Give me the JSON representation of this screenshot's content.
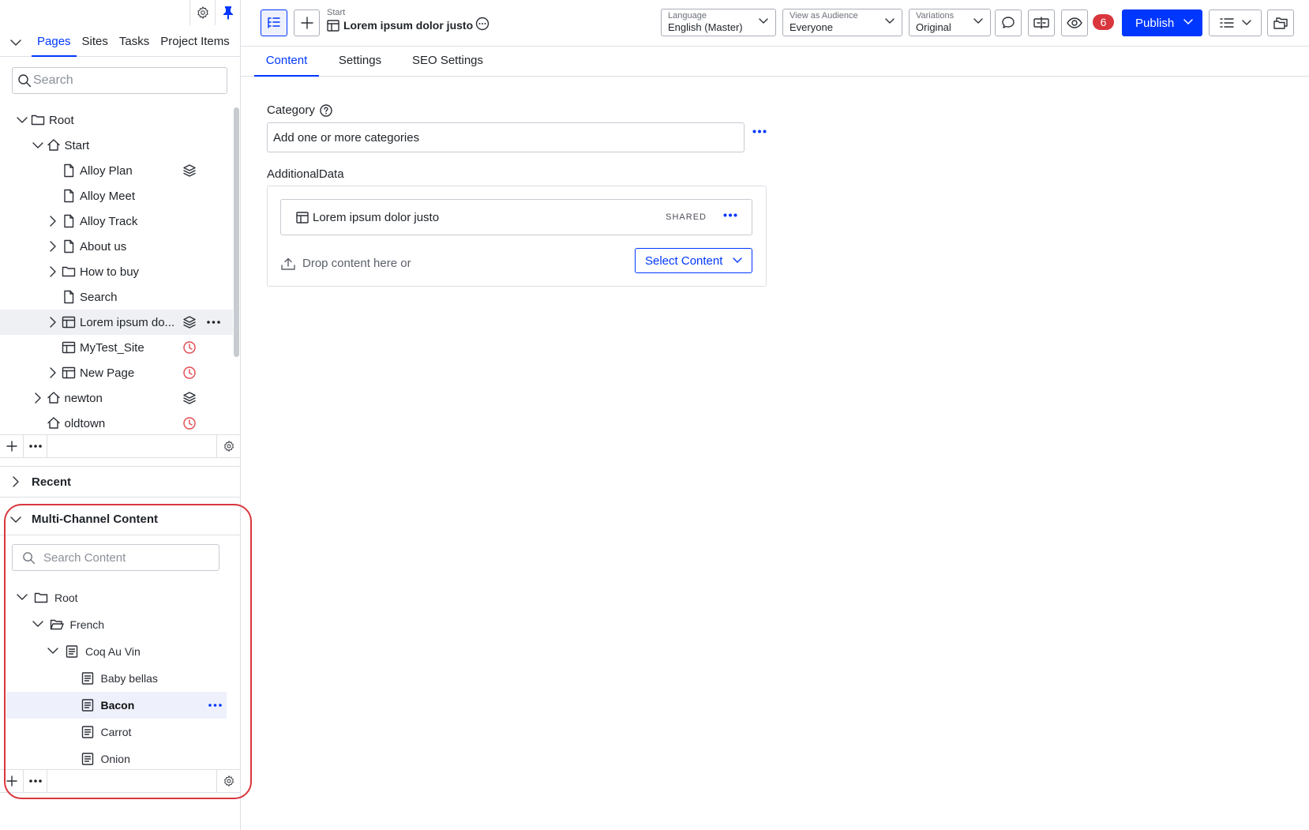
{
  "left_panel": {
    "tabs": [
      "Pages",
      "Sites",
      "Tasks",
      "Project Items"
    ],
    "active_tab": "Pages",
    "search_placeholder": "Search",
    "tree": [
      {
        "label": "Root",
        "depth": 0,
        "icon": "folder-icon",
        "expand": "open"
      },
      {
        "label": "Start",
        "depth": 1,
        "icon": "home-icon",
        "expand": "open"
      },
      {
        "label": "Alloy Plan",
        "depth": 2,
        "icon": "page-icon",
        "expand": "none",
        "status": "layers-icon"
      },
      {
        "label": "Alloy Meet",
        "depth": 2,
        "icon": "page-icon",
        "expand": "none"
      },
      {
        "label": "Alloy Track",
        "depth": 2,
        "icon": "page-icon",
        "expand": "closed"
      },
      {
        "label": "About us",
        "depth": 2,
        "icon": "page-icon",
        "expand": "closed"
      },
      {
        "label": "How to buy",
        "depth": 2,
        "icon": "folder-icon",
        "expand": "closed"
      },
      {
        "label": "Search",
        "depth": 2,
        "icon": "page-icon",
        "expand": "none"
      },
      {
        "label": "Lorem ipsum do...",
        "depth": 2,
        "icon": "block-icon",
        "expand": "closed",
        "status": "layers-icon",
        "selected": true
      },
      {
        "label": "MyTest_Site",
        "depth": 2,
        "icon": "block-icon",
        "expand": "none",
        "status": "clock-icon"
      },
      {
        "label": "New Page",
        "depth": 2,
        "icon": "block-icon",
        "expand": "closed",
        "status": "clock-icon"
      },
      {
        "label": "newton",
        "depth": 1,
        "icon": "home-icon",
        "expand": "closed",
        "status": "layers-icon"
      },
      {
        "label": "oldtown",
        "depth": 1,
        "icon": "home-icon",
        "expand": "none",
        "status": "clock-icon"
      }
    ],
    "recent_label": "Recent",
    "mcc": {
      "title": "Multi-Channel Content",
      "search_placeholder": "Search Content",
      "tree": [
        {
          "label": "Root",
          "depth": 0,
          "icon": "folder-icon",
          "expand": "open"
        },
        {
          "label": "French",
          "depth": 1,
          "icon": "folder-open-icon",
          "expand": "open"
        },
        {
          "label": "Coq Au Vin",
          "depth": 2,
          "icon": "content-icon",
          "expand": "open"
        },
        {
          "label": "Baby bellas",
          "depth": 3,
          "icon": "content-icon",
          "expand": "none"
        },
        {
          "label": "Bacon",
          "depth": 3,
          "icon": "content-icon",
          "expand": "none",
          "selected": true
        },
        {
          "label": "Carrot",
          "depth": 3,
          "icon": "content-icon",
          "expand": "none"
        },
        {
          "label": "Onion",
          "depth": 3,
          "icon": "content-icon",
          "expand": "none"
        }
      ]
    }
  },
  "header": {
    "breadcrumb": "Start",
    "title": "Lorem ipsum dolor justo",
    "language": {
      "label": "Language",
      "value": "English (Master)"
    },
    "audience": {
      "label": "View as Audience",
      "value": "Everyone"
    },
    "variations": {
      "label": "Variations",
      "value": "Original"
    },
    "notification_count": "6",
    "publish_label": "Publish",
    "accent": "#0037ff",
    "alert": "#d9363e"
  },
  "tabs": [
    "Content",
    "Settings",
    "SEO Settings"
  ],
  "form": {
    "category_label": "Category",
    "category_placeholder": "Add one or more categories",
    "additional_label": "AdditionalData",
    "item_title": "Lorem ipsum dolor justo",
    "item_tag": "SHARED",
    "drop_text": "Drop content here or",
    "select_content_label": "Select Content"
  }
}
